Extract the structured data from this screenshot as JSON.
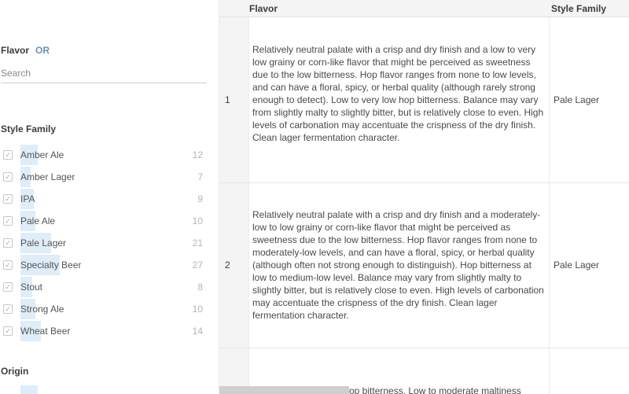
{
  "filters": {
    "flavor": {
      "title": "Flavor",
      "or_label": "OR",
      "search_placeholder": "Search"
    },
    "style_family": {
      "title": "Style Family",
      "items": [
        {
          "label": "Amber Ale",
          "count": "12",
          "checked": true,
          "share": 0.44
        },
        {
          "label": "Amber Lager",
          "count": "7",
          "checked": true,
          "share": 0.26
        },
        {
          "label": "IPA",
          "count": "9",
          "checked": true,
          "share": 0.33
        },
        {
          "label": "Pale Ale",
          "count": "10",
          "checked": true,
          "share": 0.37
        },
        {
          "label": "Pale Lager",
          "count": "21",
          "checked": true,
          "share": 0.78
        },
        {
          "label": "Specialty Beer",
          "count": "27",
          "checked": true,
          "share": 1.0
        },
        {
          "label": "Stout",
          "count": "8",
          "checked": true,
          "share": 0.3
        },
        {
          "label": "Strong Ale",
          "count": "10",
          "checked": true,
          "share": 0.37
        },
        {
          "label": "Wheat Beer",
          "count": "14",
          "checked": true,
          "share": 0.52
        }
      ]
    },
    "origin": {
      "title": "Origin"
    }
  },
  "table": {
    "headers": {
      "flavor": "Flavor",
      "style_family": "Style Family"
    },
    "rows": [
      {
        "index": "1",
        "flavor": "Relatively neutral palate with a crisp and dry finish and a low to very low grainy or corn-like flavor that might be perceived as sweetness due to the low bitterness. Hop flavor ranges from none to low levels, and can have a floral, spicy, or herbal quality (although rarely strong enough to detect). Low to very low hop bitterness. Balance may vary from slightly malty to slightly bitter, but is relatively close to even. High levels of carbonation may accentuate the crispness of the dry finish. Clean lager fermentation character.",
        "style_family": "Pale Lager"
      },
      {
        "index": "2",
        "flavor": "Relatively neutral palate with a crisp and dry finish and a moderately-low to low grainy or corn-like flavor that might be perceived as sweetness due to the low bitterness. Hop flavor ranges from none to moderately-low levels, and can have a floral, spicy, or herbal quality (although often not strong enough to distinguish). Hop bitterness at low to medium-low level. Balance may vary from slightly malty to slightly bitter, but is relatively close to even. High levels of carbonation may accentuate the crispness of the dry finish. Clean lager fermentation character.",
        "style_family": "Pale Lager"
      }
    ],
    "partial_row_text": "op bitterness. Low to moderate maltiness"
  },
  "colors": {
    "accent": "#6d8fb5",
    "facet_bar": "#deedf8",
    "header_bg": "#f4f4f4"
  }
}
